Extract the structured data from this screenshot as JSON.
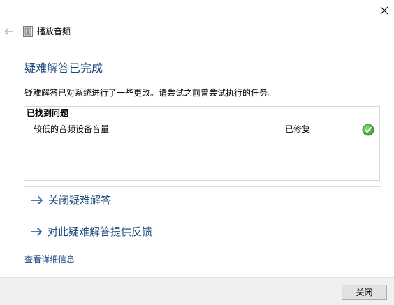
{
  "window": {
    "title": "播放音频"
  },
  "heading": "疑难解答已完成",
  "description": "疑难解答已对系统进行了一些更改。请尝试之前曾尝试执行的任务。",
  "problems": {
    "header": "已找到问题",
    "items": [
      {
        "name": "较低的音频设备音量",
        "status": "已修复",
        "status_icon": "check-icon",
        "status_color": "#3fa33f"
      }
    ]
  },
  "links": {
    "close_troubleshooter": "关闭疑难解答",
    "feedback": "对此疑难解答提供反馈",
    "details": "查看详细信息"
  },
  "footer": {
    "close_button": "关闭"
  },
  "colors": {
    "link": "#1a4a7e",
    "heading": "#1a4a7e",
    "arrow": "#2a6db0",
    "footer_bg": "#f0f0f0"
  }
}
